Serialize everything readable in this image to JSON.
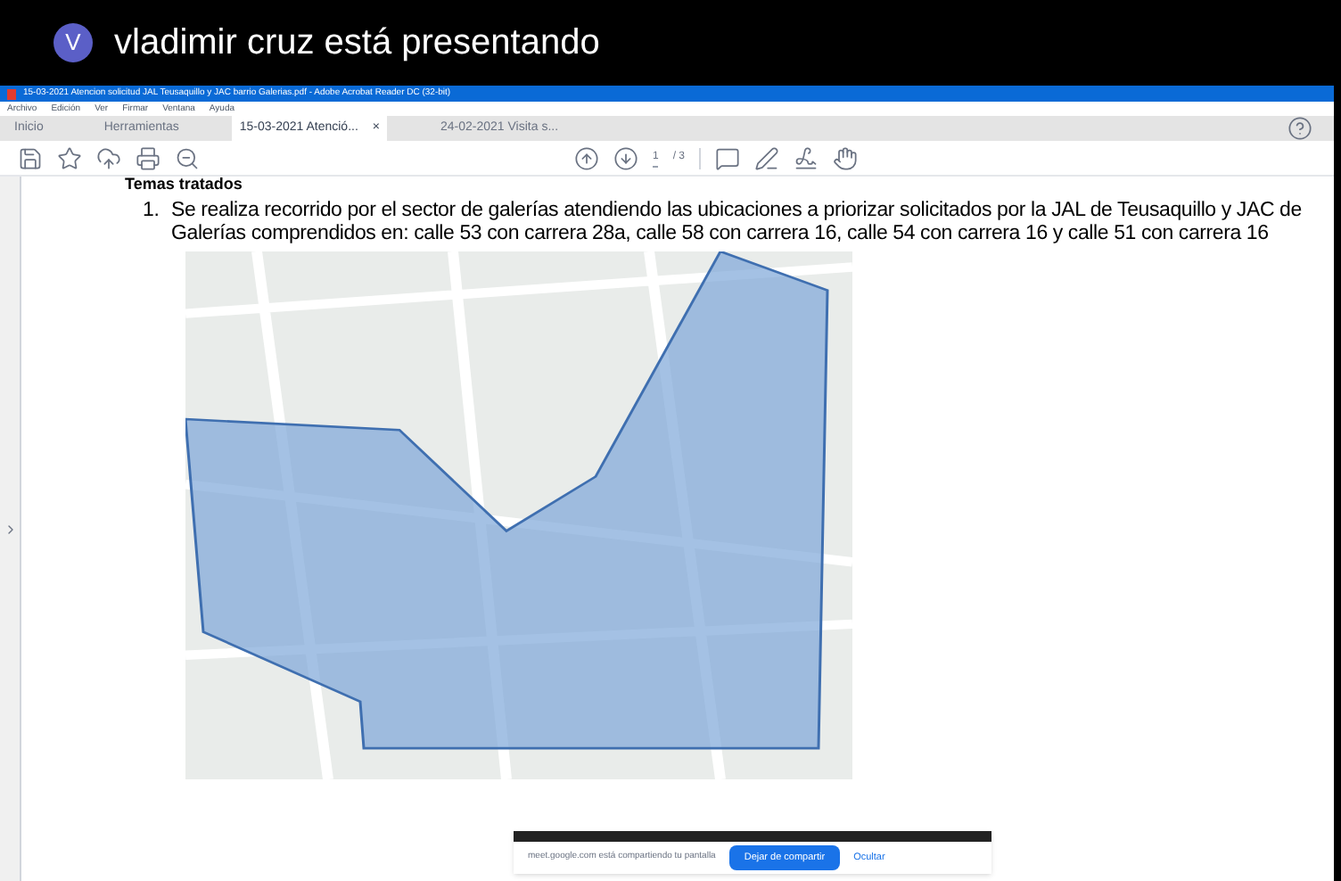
{
  "meeting": {
    "avatar": "V",
    "title": "vladimir cruz está presentando"
  },
  "window": {
    "title": "15-03-2021 Atencion solicitud JAL Teusaquillo y JAC barrio Galerias.pdf - Adobe Acrobat Reader DC (32-bit)"
  },
  "menu": [
    "Archivo",
    "Edición",
    "Ver",
    "Firmar",
    "Ventana",
    "Ayuda"
  ],
  "tabs": [
    {
      "label": "Inicio",
      "selected": false
    },
    {
      "label": "Herramientas",
      "selected": false
    },
    {
      "label": "15-03-2021 Atenció...",
      "selected": true,
      "close": "×"
    },
    {
      "label": "24-02-2021 Visita s...",
      "selected": false
    }
  ],
  "page": {
    "current": "1",
    "total": "/ 3"
  },
  "document": {
    "heading": "Temas tratados",
    "items": [
      {
        "number": "1.",
        "text": "Se realiza recorrido por el sector de galerías atendiendo las ubicaciones a priorizar solicitados por la JAL de Teusaquillo y JAC de Galerías comprendidos en: calle 53 con carrera 28a, calle 58 con carrera 16, calle 54 con carrera 16 y calle 51 con carrera 16"
      }
    ]
  },
  "share_bar": {
    "message": "meet.google.com está compartiendo tu pantalla",
    "stop_button": "Dejar de compartir",
    "hide_link": "Ocultar"
  }
}
